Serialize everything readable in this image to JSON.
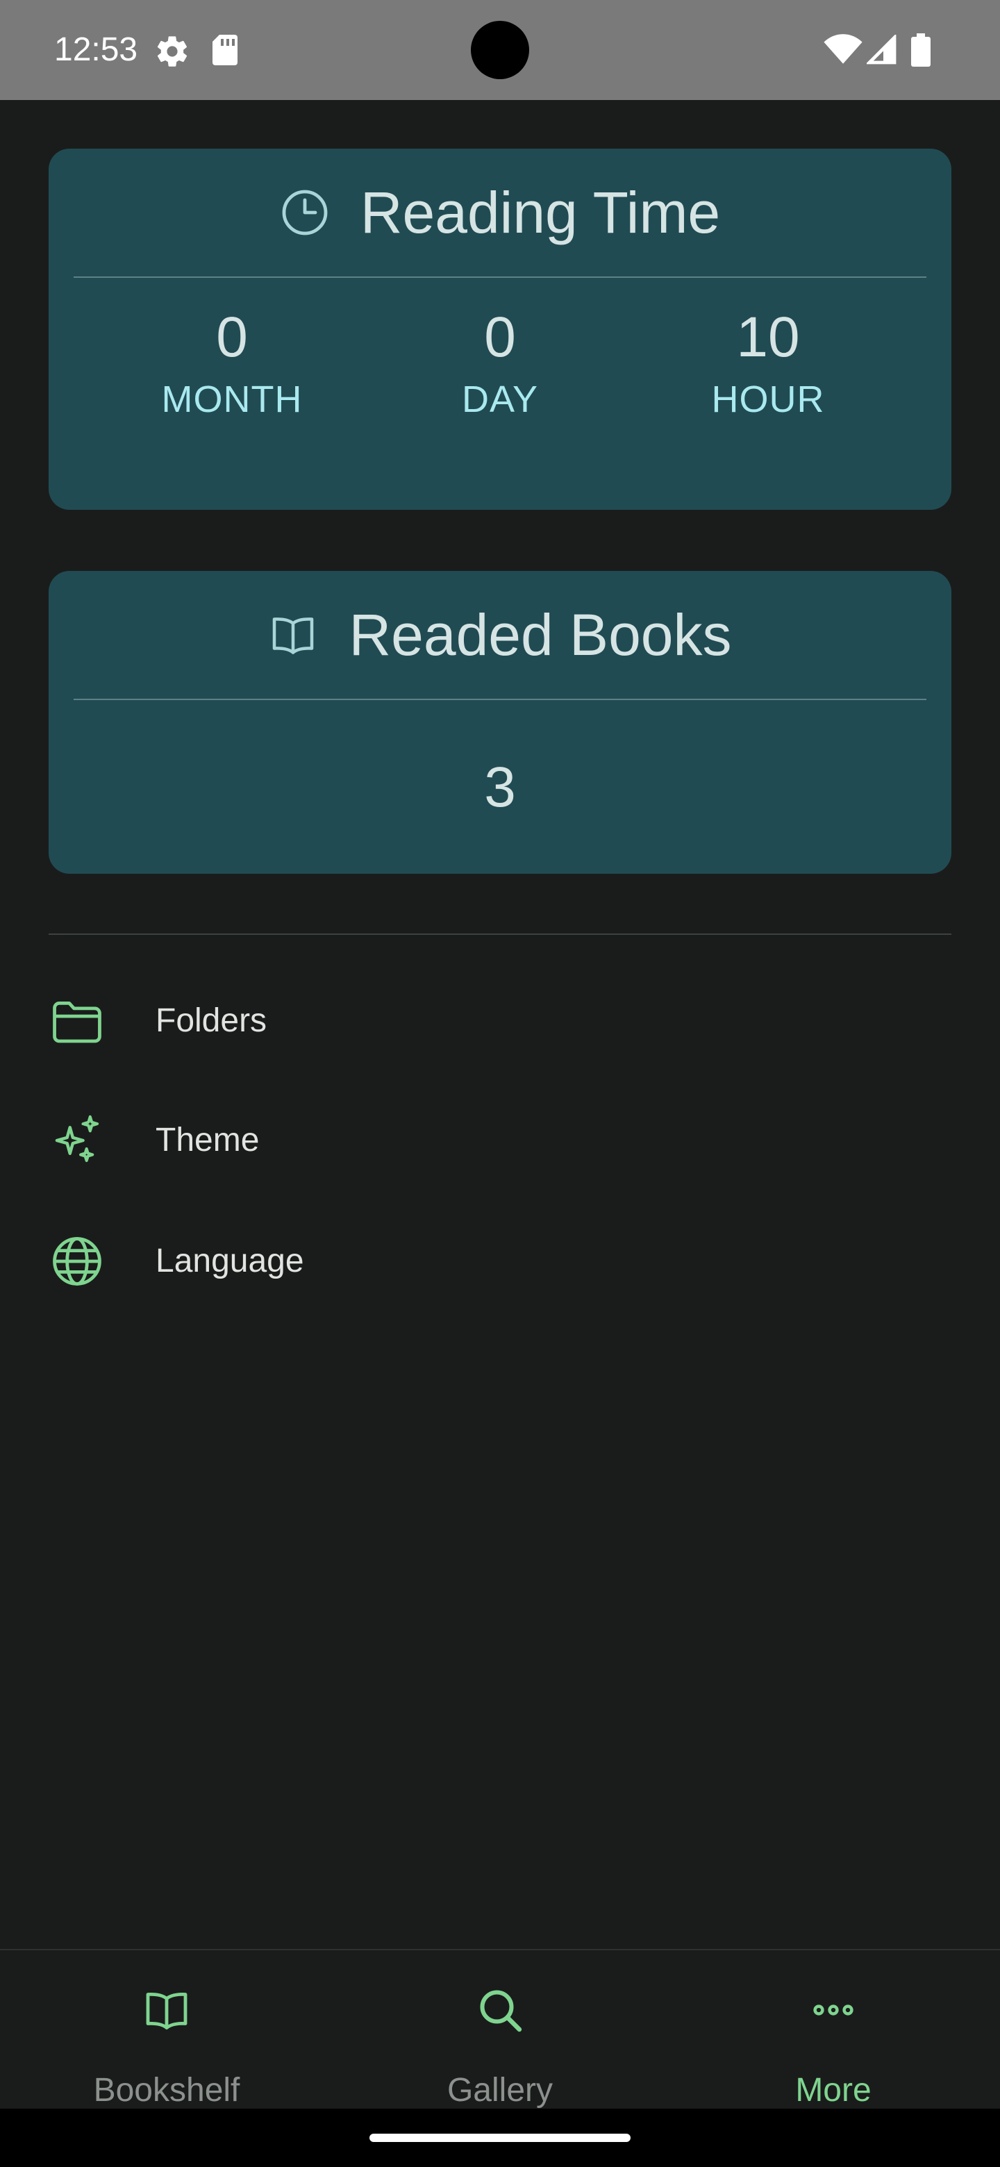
{
  "status_bar": {
    "time": "12:53",
    "icons": [
      "settings-gear-icon",
      "sd-card-icon",
      "wifi-icon",
      "cell-signal-icon",
      "battery-icon"
    ]
  },
  "reading_time": {
    "title": "Reading Time",
    "icon": "clock-icon",
    "stats": [
      {
        "value": "0",
        "label": "MONTH"
      },
      {
        "value": "0",
        "label": "DAY"
      },
      {
        "value": "10",
        "label": "HOUR"
      }
    ]
  },
  "readed_books": {
    "title": "Readed Books",
    "icon": "open-book-icon",
    "count": "3"
  },
  "menu": [
    {
      "label": "Folders",
      "icon": "folder-icon"
    },
    {
      "label": "Theme",
      "icon": "sparkles-icon"
    },
    {
      "label": "Language",
      "icon": "globe-icon"
    }
  ],
  "bottom_nav": {
    "items": [
      {
        "label": "Bookshelf",
        "icon": "book-icon"
      },
      {
        "label": "Gallery",
        "icon": "search-icon"
      },
      {
        "label": "More",
        "icon": "more-dots-icon"
      }
    ],
    "active": "More"
  },
  "colors": {
    "card_bg": "#214b53",
    "accent": "#7fd48f",
    "stat_label": "#a9e9ef",
    "background": "#1a1c1b",
    "status_bar": "#7a7a7a"
  }
}
